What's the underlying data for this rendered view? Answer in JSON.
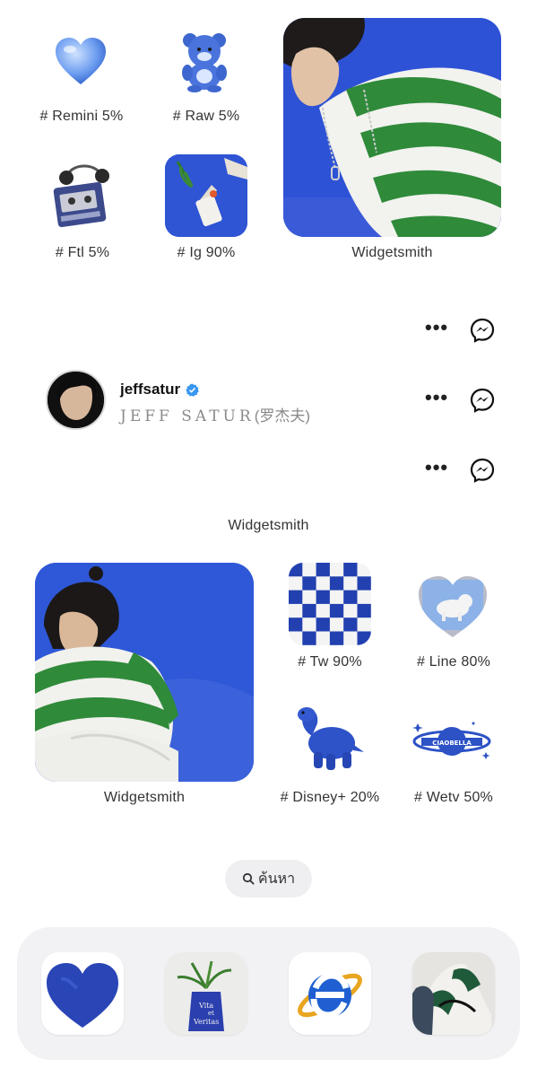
{
  "apps_top": [
    {
      "label": "# Remini 5%",
      "icon": "heart-glass-icon"
    },
    {
      "label": "# Raw 5%",
      "icon": "teddy-bear-icon"
    },
    {
      "label": "# Ftl 5%",
      "icon": "cassette-player-icon"
    },
    {
      "label": "# Ig 90%",
      "icon": "plant-bag-photo-icon"
    }
  ],
  "widget_top": {
    "label": "Widgetsmith"
  },
  "instagram": {
    "username": "jeffsatur",
    "display_name": "JEFF SATUR",
    "display_name_suffix": "(罗杰夫)",
    "verified": true
  },
  "widget_middle": {
    "label": "Widgetsmith"
  },
  "widget_bottom": {
    "label": "Widgetsmith"
  },
  "apps_bottom": [
    {
      "label": "# Tw 90%",
      "icon": "checkerboard-icon"
    },
    {
      "label": "# Line 80%",
      "icon": "heart-cat-photo-icon"
    },
    {
      "label": "# Disney+ 20%",
      "icon": "plush-dinosaur-icon"
    },
    {
      "label": "# Wetv 50%",
      "icon": "planet-logo-icon"
    }
  ],
  "search": {
    "label": "ค้นหา"
  },
  "dock": [
    {
      "icon": "painted-heart-icon"
    },
    {
      "icon": "vita-et-veritas-vase-icon"
    },
    {
      "icon": "internet-explorer-icon"
    },
    {
      "icon": "sneaker-photo-icon"
    }
  ],
  "colors": {
    "accent_blue": "#2c4fd1",
    "green_stripe": "#2f8a3a",
    "verified_blue": "#3897f0"
  }
}
